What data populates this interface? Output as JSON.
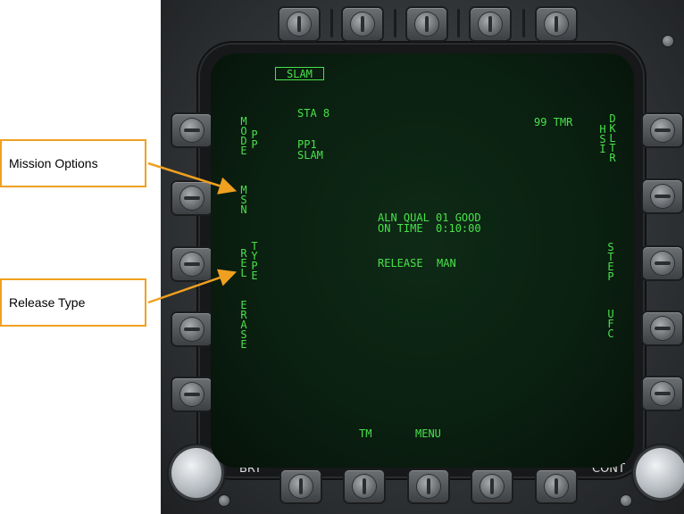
{
  "callouts": {
    "mission_options": "Mission Options",
    "release_type": "Release Type"
  },
  "display": {
    "title": "SLAM",
    "station": "STA 8",
    "timer": "99 TMR",
    "pp_line1": "PP1",
    "pp_line2": "SLAM",
    "aln_qual": "ALN QUAL 01 GOOD",
    "on_time": "ON TIME  0:10:00",
    "release_label": "RELEASE",
    "release_value": "MAN",
    "bottom_tm": "TM",
    "bottom_menu": "MENU"
  },
  "left_options": {
    "mode": "MODE",
    "pp": "PP",
    "msn": "MSN",
    "rel": "REL",
    "type": "TYPE",
    "erase": "ERASE"
  },
  "right_options": {
    "hsi": "HSI",
    "dkltr": "DKLTR",
    "step": "STEP",
    "ufc": "UFC"
  },
  "bezel": {
    "brt_label": "BRT",
    "cont_label": "CONT"
  },
  "colors": {
    "symbology": "#49e24a",
    "callout_border": "#f0a020",
    "bezel": "#323538"
  }
}
